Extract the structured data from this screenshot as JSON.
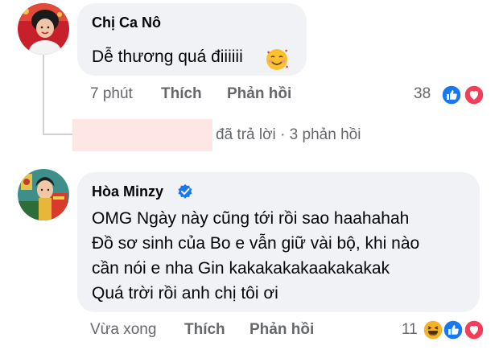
{
  "comments": [
    {
      "author": "Chị Ca Nô",
      "text_lines": [
        "Dễ thương quá điiiiii"
      ],
      "emoji": "smiling-face-with-hearts",
      "time": "7 phút",
      "like_label": "Thích",
      "reply_label": "Phản hồi",
      "reaction_count": "38",
      "reactions": [
        "like",
        "love"
      ]
    },
    {
      "author": "Hòa Minzy",
      "verified": true,
      "text_lines": [
        "OMG Ngày này cũng tới rồi sao haahahah",
        "Đồ sơ sinh của Bo e vẫn giữ vài bộ, khi nào",
        "cần nói e nha Gin kakakakakaakakakak",
        "Quá trời rồi anh chị tôi ơi"
      ],
      "time": "Vừa xong",
      "like_label": "Thích",
      "reply_label": "Phản hồi",
      "reaction_count": "11",
      "reactions": [
        "haha",
        "like",
        "love"
      ]
    }
  ],
  "reply_summary": {
    "replied_text": "đã trả lời",
    "separator": "·",
    "count_text": "3 phản hồi"
  },
  "colors": {
    "bubble": "#f0f2f5",
    "meta_text": "#65676b",
    "like_blue": "#1877f2",
    "love_red": "#f33e58",
    "haha_yellow": "#f7b125",
    "verified_blue": "#1877f2",
    "redaction_pink": "#fde6e4"
  }
}
